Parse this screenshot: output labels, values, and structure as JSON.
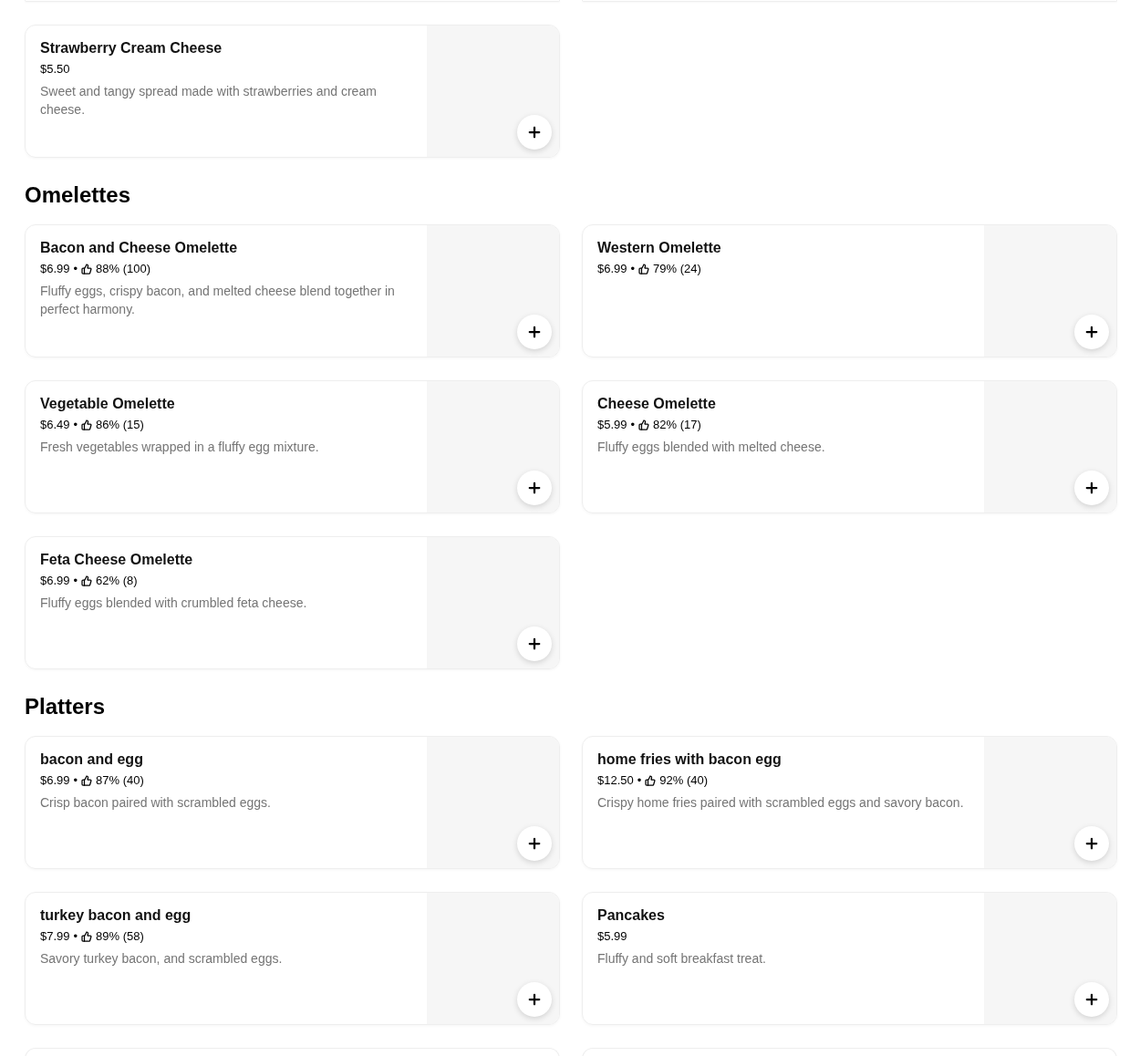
{
  "top_section": {
    "items": [
      {
        "name": "Strawberry Cream Cheese",
        "price": "$5.50",
        "description": "Sweet and tangy spread made with strawberries and cream cheese."
      }
    ]
  },
  "sections": [
    {
      "title": "Omelettes",
      "items": [
        {
          "name": "Bacon and Cheese Omelette",
          "price": "$6.99",
          "separator": "•",
          "rating": "88% (100)",
          "description": "Fluffy eggs, crispy bacon, and melted cheese blend together in perfect harmony."
        },
        {
          "name": "Western Omelette",
          "price": "$6.99",
          "separator": "•",
          "rating": "79% (24)"
        },
        {
          "name": "Vegetable Omelette",
          "price": "$6.49",
          "separator": "•",
          "rating": "86% (15)",
          "description": "Fresh vegetables wrapped in a fluffy egg mixture."
        },
        {
          "name": "Cheese Omelette",
          "price": "$5.99",
          "separator": "•",
          "rating": "82% (17)",
          "description": "Fluffy eggs blended with melted cheese."
        },
        {
          "name": "Feta Cheese Omelette",
          "price": "$6.99",
          "separator": "•",
          "rating": "62% (8)",
          "description": "Fluffy eggs blended with crumbled feta cheese."
        }
      ]
    },
    {
      "title": "Platters",
      "items": [
        {
          "name": "bacon and egg",
          "price": "$6.99",
          "separator": "•",
          "rating": "87% (40)",
          "description": "Crisp bacon paired with scrambled eggs."
        },
        {
          "name": "home fries with bacon egg",
          "price": "$12.50",
          "separator": "•",
          "rating": "92% (40)",
          "description": "Crispy home fries paired with scrambled eggs and savory bacon."
        },
        {
          "name": "turkey bacon and egg",
          "price": "$7.99",
          "separator": "•",
          "rating": "89% (58)",
          "description": "Savory turkey bacon, and scrambled eggs."
        },
        {
          "name": "Pancakes",
          "price": "$5.99",
          "description": "Fluffy and soft breakfast treat."
        }
      ]
    }
  ]
}
